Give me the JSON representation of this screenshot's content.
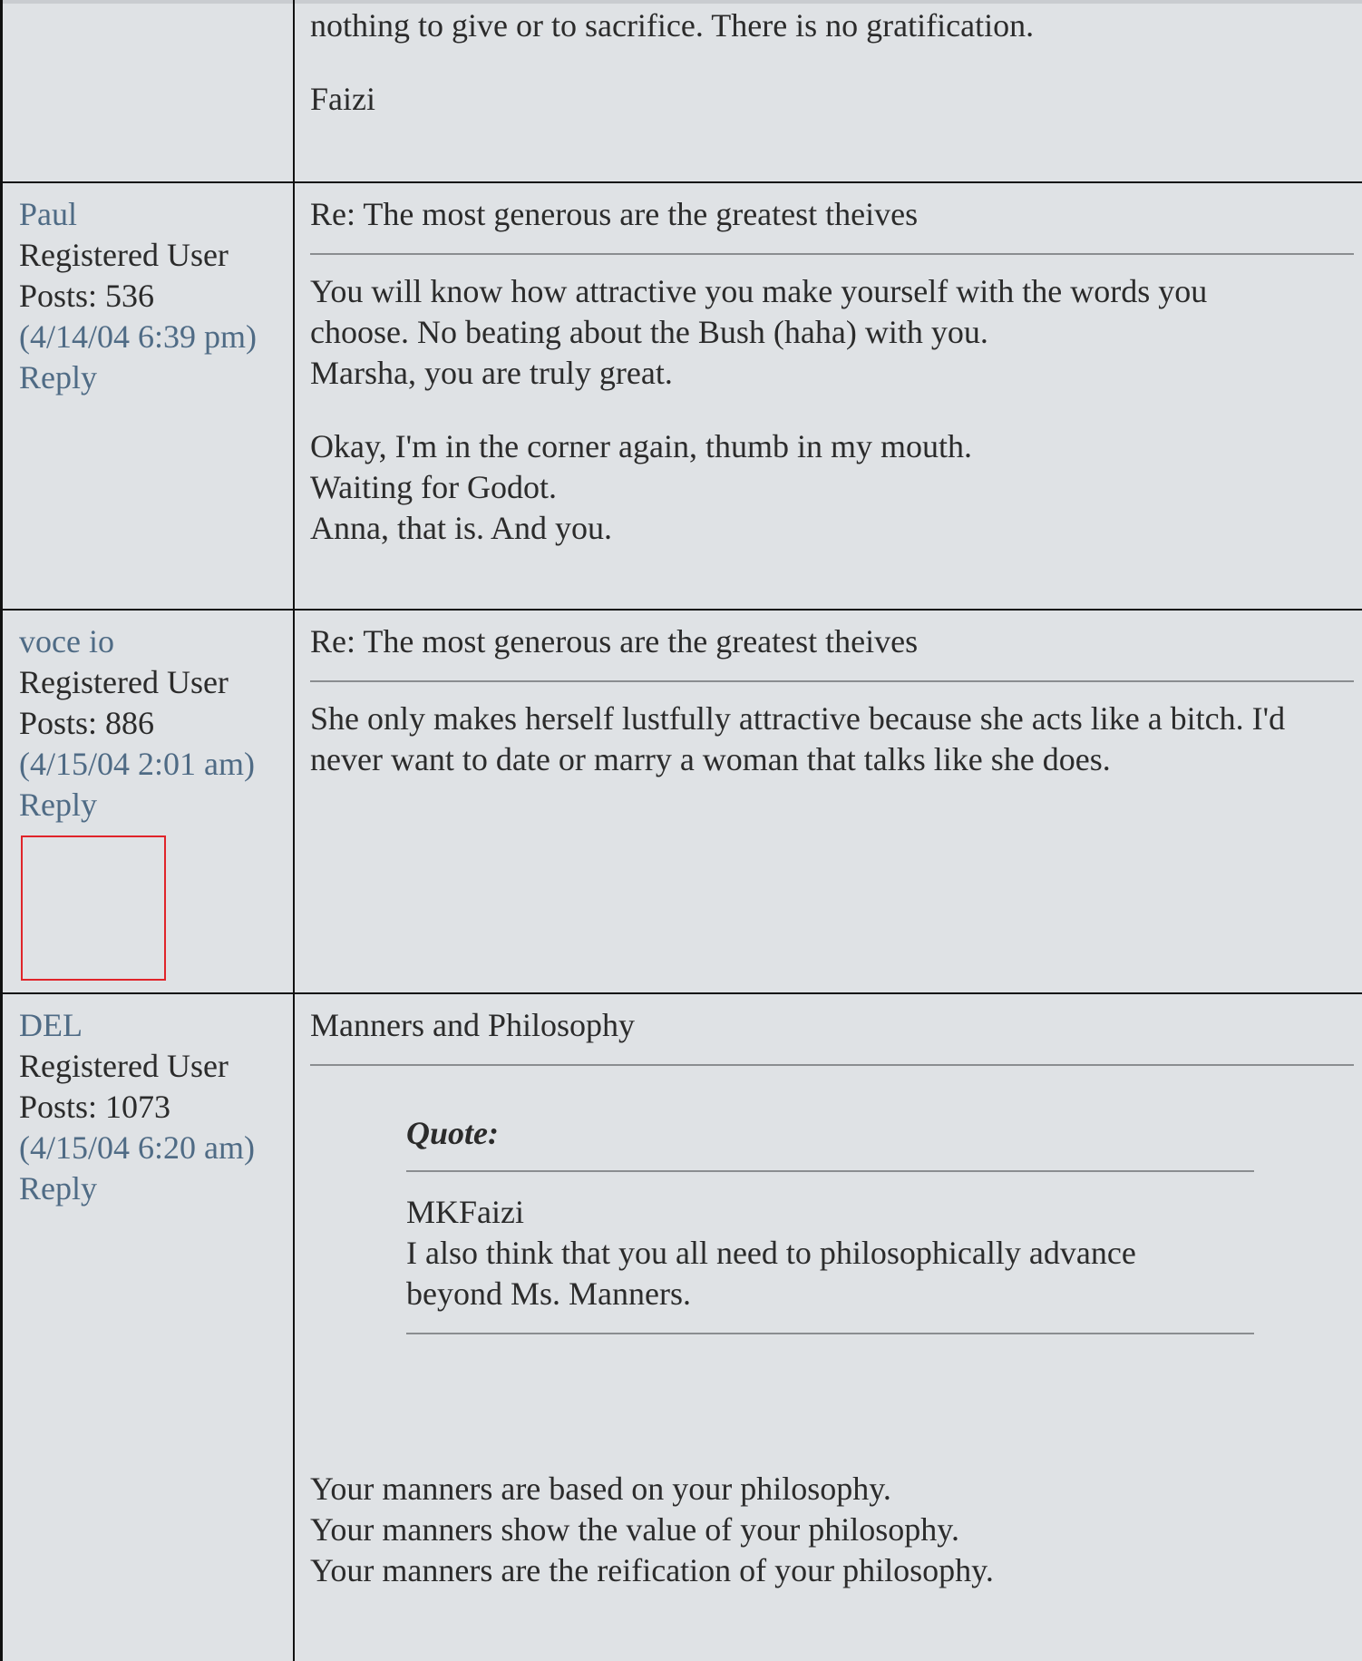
{
  "posts": [
    {
      "body_lines_a": [
        "nothing to give or to sacrifice. There is no gratification."
      ],
      "signature": "Faizi"
    },
    {
      "username": "Paul",
      "role": "Registered User",
      "posts_count": "Posts: 536",
      "date": "(4/14/04 6:39 pm)",
      "reply_label": "Reply",
      "subject": "Re: The most generous are the greatest theives",
      "para1": [
        "You will know how attractive you make yourself with the words you",
        "choose. No beating about the Bush (haha) with you.",
        "Marsha, you are truly great."
      ],
      "para2": [
        "Okay, I'm in the corner again, thumb in my mouth.",
        "Waiting for Godot.",
        "Anna, that is. And you."
      ]
    },
    {
      "username": "voce io",
      "role": "Registered User",
      "posts_count": "Posts: 886",
      "date": "(4/15/04 2:01 am)",
      "reply_label": "Reply",
      "subject": "Re: The most generous are the greatest theives",
      "para1": [
        "She only makes herself lustfully attractive because she acts like a bitch. I'd",
        "never want to date or marry a woman that talks like she does."
      ]
    },
    {
      "username": "DEL",
      "role": "Registered User",
      "posts_count": "Posts: 1073",
      "date": "(4/15/04 6:20 am)",
      "reply_label": "Reply",
      "subject": "Manners and Philosophy",
      "quote_label": "Quote:",
      "quote_lines": [
        "MKFaizi",
        "I also think that you all need to philosophically advance",
        "beyond Ms. Manners."
      ],
      "para1": [
        "Your manners are based on your philosophy.",
        "Your manners show the value of your philosophy.",
        "Your manners are the reification of your philosophy."
      ]
    }
  ],
  "colors": {
    "background": "#dfe2e5",
    "link": "#4f6b85",
    "border": "#111111",
    "avatar_outline": "#e0242a"
  }
}
